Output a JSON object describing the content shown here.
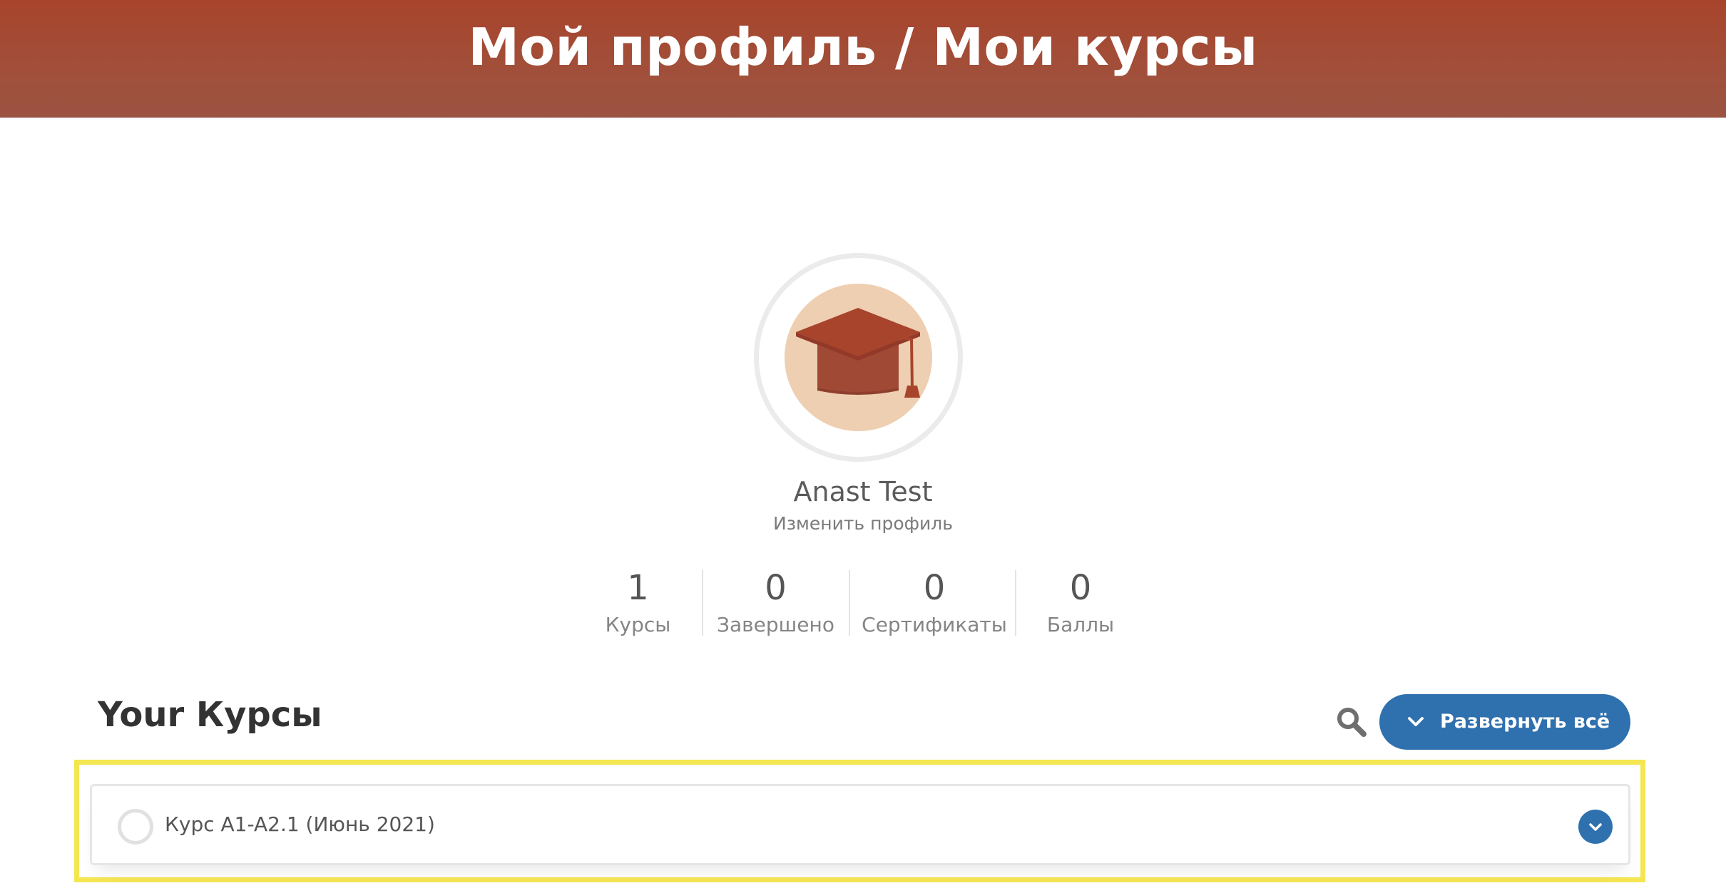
{
  "header": {
    "title": "Мой профиль / Мои курсы"
  },
  "profile": {
    "name": "Anast Test",
    "edit_link": "Изменить профиль",
    "avatar_icon": "graduation-cap-icon"
  },
  "stats": [
    {
      "value": "1",
      "label": "Курсы"
    },
    {
      "value": "0",
      "label": "Завершено"
    },
    {
      "value": "0",
      "label": "Сертификаты"
    },
    {
      "value": "0",
      "label": "Баллы"
    }
  ],
  "courses_section": {
    "title": "Your Курсы",
    "search_icon": "search-icon",
    "expand_all_label": "Развернуть всё"
  },
  "courses": [
    {
      "title": "Курс A1-A2.1 (Июнь 2021)",
      "completed": false
    }
  ],
  "colors": {
    "header_bg": "#a8442c",
    "accent_blue": "#2f70ae",
    "avatar_bg": "#eecfb1",
    "cap_color": "#a4432c",
    "highlight_yellow": "#f4e651"
  }
}
